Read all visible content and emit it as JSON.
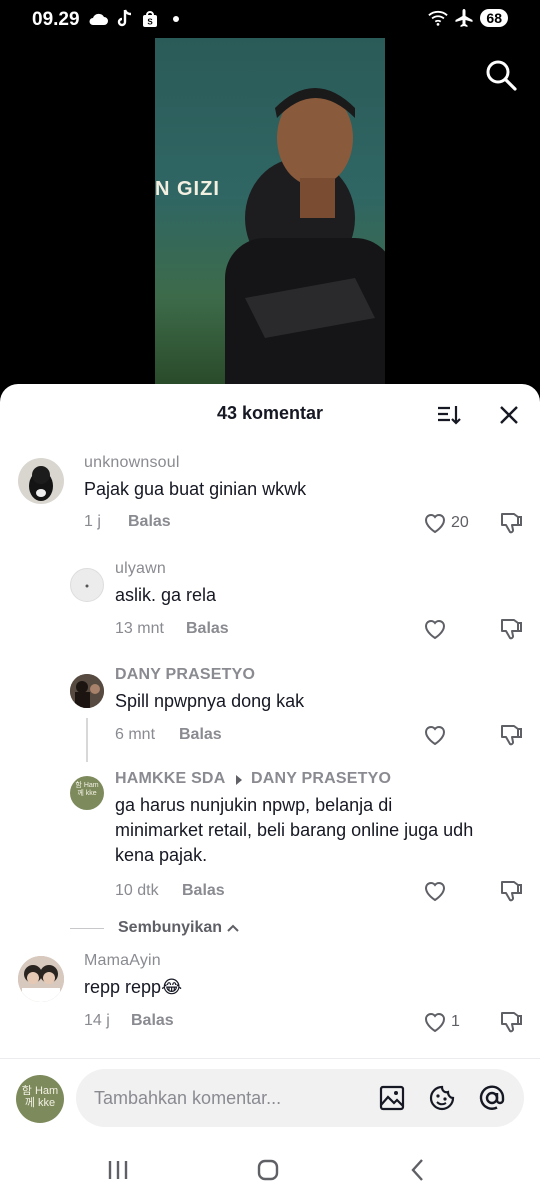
{
  "status_bar": {
    "time": "09.29",
    "battery": "68",
    "icons": [
      "cloud-icon",
      "tiktok-icon",
      "shop-icon",
      "dot-icon",
      "wifi-icon",
      "airplane-icon"
    ]
  },
  "video": {
    "sign_text": "N GIZI"
  },
  "comments_sheet": {
    "title": "43 komentar",
    "comments": [
      {
        "username": "unknownsoul",
        "text": "Pajak gua buat ginian wkwk",
        "time": "1 j",
        "reply_label": "Balas",
        "likes": "20"
      },
      {
        "username": "ulyawn",
        "text": "aslik. ga rela",
        "time": "13 mnt",
        "reply_label": "Balas",
        "likes": ""
      },
      {
        "username": "DANY PRASETYO",
        "text": "Spill npwpnya dong kak",
        "time": "6 mnt",
        "reply_label": "Balas",
        "likes": ""
      },
      {
        "username": "HAMKKE SDA",
        "reply_to": "DANY PRASETYO",
        "text_lines": [
          "ga harus nunjukin npwp, belanja di",
          "minimarket retail, beli barang online juga udh",
          "kena pajak."
        ],
        "time": "10 dtk",
        "reply_label": "Balas",
        "likes": ""
      },
      {
        "username": "MamaAyin",
        "text": "repp repp",
        "emoji": "😂",
        "time": "14 j",
        "reply_label": "Balas",
        "likes": "1"
      }
    ],
    "hide_label": "Sembunyikan",
    "input_placeholder": "Tambahkan komentar...",
    "my_avatar_lines": [
      "함",
      "Ham",
      "께",
      "kke"
    ]
  }
}
